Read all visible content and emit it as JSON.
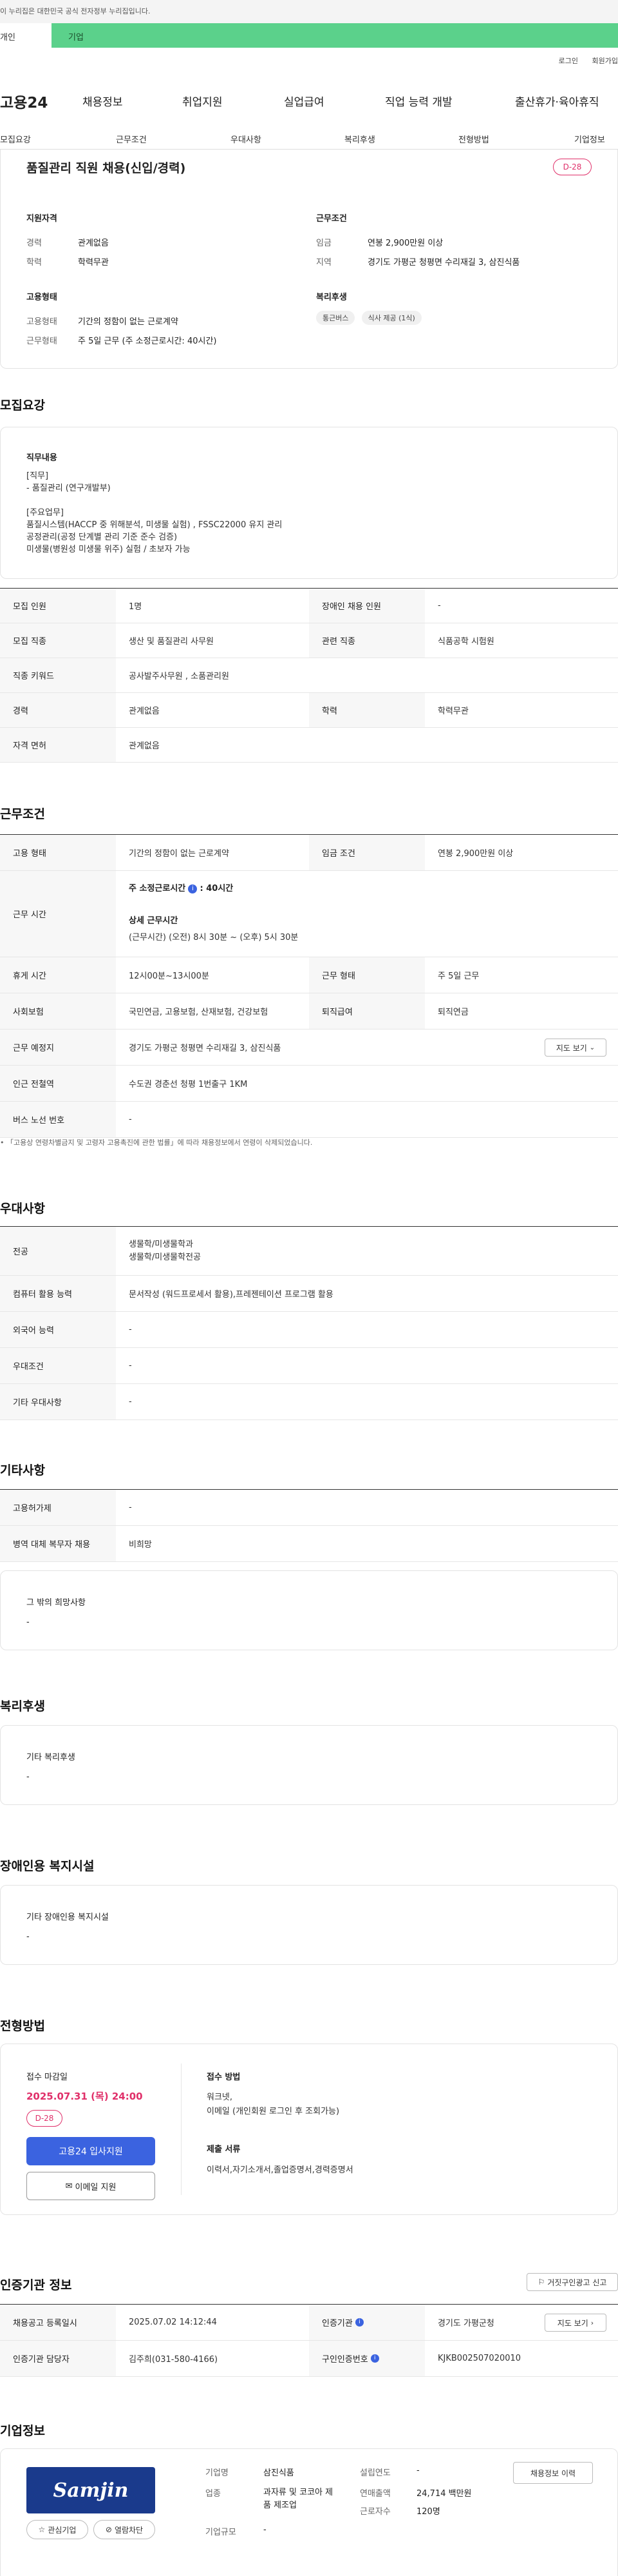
{
  "gov_banner": "이 누리집은 대한민국 공식 전자정부 누리집입니다.",
  "top_tabs": {
    "personal": "개인",
    "company": "기업"
  },
  "util_links": [
    "로그인",
    "회원가입"
  ],
  "logo": "고용24",
  "gnb": [
    "채용정보",
    "취업지원",
    "실업급여",
    "직업 능력 개발",
    "출산휴가·육아휴직"
  ],
  "subnav": [
    "모집요강",
    "근무조건",
    "우대사항",
    "복리후생",
    "전형방법",
    "기업정보"
  ],
  "summary": {
    "title": "품질관리 직원 채용(신입/경력)",
    "dday": "D-28",
    "qual_title": "지원자격",
    "qual": [
      {
        "label": "경력",
        "value": "관계없음"
      },
      {
        "label": "학력",
        "value": "학력무관"
      }
    ],
    "work_title": "근무조건",
    "work": [
      {
        "label": "임금",
        "value": "연봉 2,900만원 이상"
      },
      {
        "label": "지역",
        "value": "경기도 가평군 청평면 수리재길 3, 삼진식품"
      }
    ],
    "type_title": "고용형태",
    "types": [
      {
        "label": "고용형태",
        "value": "기간의 정함이 없는 근로계약"
      },
      {
        "label": "근무형태",
        "value": "주 5일 근무 (주 소정근로시간: 40시간)"
      }
    ],
    "welfare_title": "복리후생",
    "welfare_chips": [
      "통근버스",
      "식사 제공 (1식)"
    ]
  },
  "recruit": {
    "section_title": "모집요강",
    "job_title": "직무내용",
    "job_lines": [
      "[직무]",
      " - 품질관리 (연구개발부)",
      "",
      "[주요업무]",
      "품질시스템(HACCP 중 위해분석, 미생물 실험) , FSSC22000 유지 관리",
      "공정관리(공정 단계별 관리 기준 준수 검증)",
      "미생물(병원성 미생물 위주) 실험 / 초보자 가능"
    ],
    "rows": [
      {
        "th": "모집 인원",
        "td": "1명",
        "th2": "장애인 채용 인원",
        "td2": "-"
      },
      {
        "th": "모집 직종",
        "td": "생산 및 품질관리 사무원",
        "th2": "관련 직종",
        "td2": "식품공학 시험원"
      },
      {
        "th": "직종 키워드",
        "td": "공사발주사무원 , 소품관리원"
      },
      {
        "th": "경력",
        "td": "관계없음",
        "th2": "학력",
        "td2": "학력무관"
      },
      {
        "th": "자격 면허",
        "td": "관계없음"
      }
    ]
  },
  "conditions": {
    "section_title": "근무조건",
    "employment_type": {
      "th": "고용 형태",
      "td": "기간의 정함이 없는 근로계약",
      "th2": "임금 조건",
      "td2": "연봉 2,900만원 이상"
    },
    "work_time": {
      "th": "근무 시간",
      "weekly_label": "주 소정근로시간",
      "weekly_value": ": 40시간",
      "detail_label": "상세 근무시간",
      "detail_value": "(근무시간) (오전) 8시 30분 ~ (오후) 5시 30분"
    },
    "rows": [
      {
        "th": "휴게 시간",
        "td": "12시00분~13시00분",
        "th2": "근무 형태",
        "td2": "주 5일 근무"
      },
      {
        "th": "사회보험",
        "td": "국민연금, 고용보험, 산재보험, 건강보험",
        "th2": "퇴직급여",
        "td2": "퇴직연금"
      },
      {
        "th": "근무 예정지",
        "td": "경기도 가평군 청평면 수리재길 3, 삼진식품",
        "button": "지도 보기"
      },
      {
        "th": "인근 전철역",
        "td": "수도권 경춘선 청평 1번출구 1KM"
      },
      {
        "th": "버스 노선 번호",
        "td": "-"
      }
    ],
    "note": "「고용상 연령차별금지 및 고령자 고용촉진에 관한 법률」에 따라 채용정보에서 연령이 삭제되었습니다."
  },
  "preference": {
    "section_title": "우대사항",
    "major_th": "전공",
    "major_lines": [
      "생물학/미생물학과",
      "생물학/미생물학전공"
    ],
    "rows": [
      {
        "th": "컴퓨터 활용 능력",
        "td": "문서작성 (워드프로세서 활용),프레젠테이션 프로그램 활용"
      },
      {
        "th": "외국어 능력",
        "td": "-"
      },
      {
        "th": "우대조건",
        "td": "-"
      },
      {
        "th": "기타 우대사항",
        "td": "-"
      }
    ]
  },
  "others": {
    "section_title": "기타사항",
    "rows": [
      {
        "th": "고용허가제",
        "td": "-"
      },
      {
        "th": "병역 대체 복무자 채용",
        "td": "비희망"
      }
    ],
    "box_title": "그 밖의 희망사항",
    "box_value": "-"
  },
  "welfare": {
    "section_title": "복리후생",
    "box_title": "기타 복리후생",
    "box_value": "-"
  },
  "disability": {
    "section_title": "장애인용 복지시설",
    "box_title": "기타 장애인용 복지시설",
    "box_value": "-"
  },
  "selection": {
    "section_title": "전형방법",
    "deadline_label": "접수 마감일",
    "deadline": "2025.07.31 (목) 24:00",
    "dday": "D-28",
    "apply_button": "고용24 입사지원",
    "email_button": "이메일 지원",
    "method_label": "접수 방법",
    "method_lines": [
      "워크넷,",
      "이메일 (개인회원 로그인 후 조회가능)"
    ],
    "docs_label": "제출 서류",
    "docs_value": "이력서,자기소개서,졸업증명서,경력증명서"
  },
  "agency": {
    "section_title": "인증기관 정보",
    "report_button": "거짓구인광고 신고",
    "rows": [
      {
        "th": "채용공고 등록일시",
        "td": "2025.07.02 14:12:44",
        "th2": "인증기관",
        "td2": "경기도 가평군청",
        "button": "지도 보기"
      },
      {
        "th": "인증기관 담당자",
        "td": "김주희(031-580-4166)",
        "th2": "구인인증번호",
        "td2": "KJKB002507020010"
      }
    ]
  },
  "company": {
    "section_title": "기업정보",
    "logo_text": "Samjin",
    "fav_button": "관심기업",
    "block_button": "열람차단",
    "fields": [
      {
        "label": "기업명",
        "value": "삼진식품"
      },
      {
        "label": "업종",
        "value": "과자류 및 코코아 제품 제조업"
      },
      {
        "label": "기업규모",
        "value": "-"
      }
    ],
    "fields2": [
      {
        "label": "설립연도",
        "value": "-"
      },
      {
        "label": "연매출액",
        "value": "24,714 백만원"
      },
      {
        "label": "근로자수",
        "value": "120명"
      }
    ],
    "history_button": "채용정보 이력"
  }
}
